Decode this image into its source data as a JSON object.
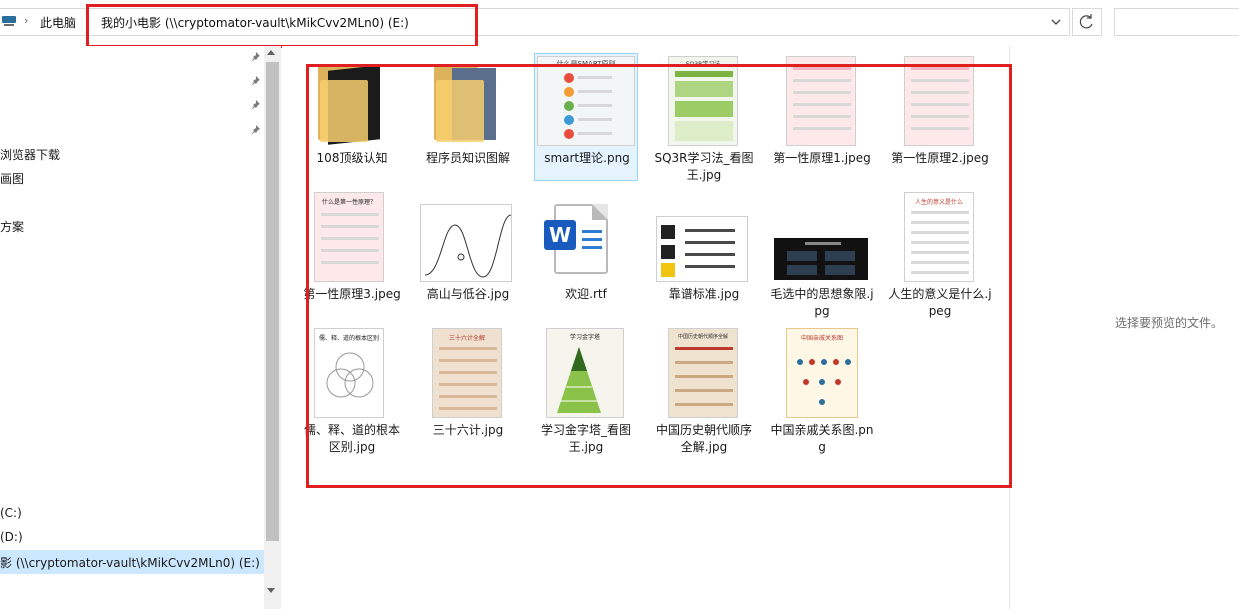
{
  "address": {
    "crumbs": [
      "此电脑",
      "我的小电影 (\\\\cryptomator-vault\\kMikCvv2MLn0) (E:)"
    ],
    "separator": "›"
  },
  "nav": {
    "items": [
      {
        "label": "浏览器下载"
      },
      {
        "label": "画图"
      },
      {
        "label": "方案"
      },
      {
        "label": "(C:)"
      },
      {
        "label": "(D:)"
      },
      {
        "label": "影 (\\\\cryptomator-vault\\kMikCvv2MLn0) (E:)"
      }
    ]
  },
  "files": [
    {
      "name": "108顶级认知",
      "kind": "folder"
    },
    {
      "name": "程序员知识图解",
      "kind": "folder"
    },
    {
      "name": "smart理论.png",
      "kind": "image",
      "selected": true
    },
    {
      "name": "SQ3R学习法_看图王.jpg",
      "kind": "image"
    },
    {
      "name": "第一性原理1.jpeg",
      "kind": "image"
    },
    {
      "name": "第一性原理2.jpeg",
      "kind": "image"
    },
    {
      "name": "第一性原理3.jpeg",
      "kind": "image"
    },
    {
      "name": "高山与低谷.jpg",
      "kind": "image"
    },
    {
      "name": "欢迎.rtf",
      "kind": "word-doc"
    },
    {
      "name": "靠谱标准.jpg",
      "kind": "image"
    },
    {
      "name": "毛选中的思想象限.jpg",
      "kind": "image"
    },
    {
      "name": "人生的意义是什么.jpeg",
      "kind": "image"
    },
    {
      "name": "儒、释、道的根本区别.jpg",
      "kind": "image"
    },
    {
      "name": "三十六计.jpg",
      "kind": "image"
    },
    {
      "name": "学习金字塔_看图王.jpg",
      "kind": "image"
    },
    {
      "name": "中国历史朝代顺序全解.jpg",
      "kind": "image"
    },
    {
      "name": "中国亲戚关系图.png",
      "kind": "image"
    }
  ],
  "thumb_text": {
    "smart": "什么是SMART原则",
    "sq3r": "SQ3R学习法",
    "fp3": "什么是第一性原理？",
    "life": "人生的意义是什么",
    "rsd": "儒、释、道的根本区别",
    "s36": "三十六计全解",
    "pyramid": "学习金字塔",
    "dynasty": "中国历史朝代顺序全解",
    "family": "中国亲戚关系图",
    "word_letter": "W"
  },
  "preview": {
    "text": "选择要预览的文件。"
  },
  "colors": {
    "highlight": "#e02020",
    "selection": "#cce8ff",
    "folder": "#f7cf6d",
    "word": "#185abd"
  }
}
